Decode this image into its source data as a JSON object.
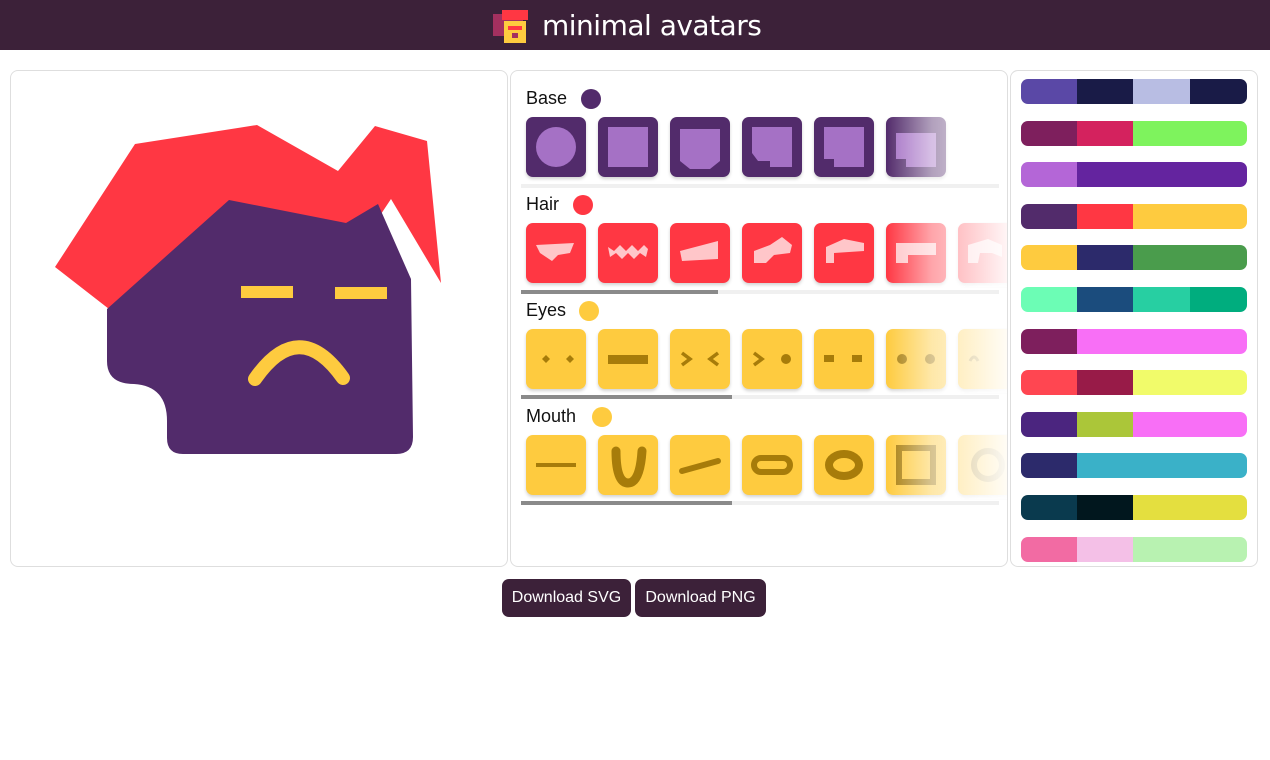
{
  "app": {
    "title": "minimal avatars",
    "logo_icon": "pixel-avatar-logo-icon",
    "header_color": "#3c2139"
  },
  "avatar": {
    "base_color": "#522b6b",
    "hair_color": "#ff3743",
    "eyes_color": "#fecb3f",
    "mouth_color": "#fecb3f",
    "expression": "frown",
    "hair_style": "spiky"
  },
  "sections": {
    "base": {
      "label": "Base",
      "color": "#522b6b",
      "shape_color": "#a571c5",
      "options": [
        "circle",
        "square",
        "cut-square",
        "notched",
        "tab",
        "step"
      ]
    },
    "hair": {
      "label": "Hair",
      "color": "#ff3743",
      "shape_color": "#ffc6c9",
      "options": [
        "wave",
        "zigzag",
        "wedge",
        "spike",
        "bob",
        "block",
        "arch"
      ]
    },
    "eyes": {
      "label": "Eyes",
      "color": "#fecb3f",
      "shape_color": "#a77c0a",
      "options": [
        "diamonds",
        "bar",
        "angles",
        "wink",
        "dashes",
        "dots",
        "arc"
      ]
    },
    "mouth": {
      "label": "Mouth",
      "color": "#fecb3f",
      "shape_color": "#a77c0a",
      "options": [
        "line",
        "u-shape",
        "slant",
        "pill",
        "ring",
        "square",
        "circle"
      ]
    }
  },
  "palettes": [
    [
      "#5a48a6",
      "#191b47",
      "#b8bde3",
      "#191b47"
    ],
    [
      "#7e1f5d",
      "#d4225e",
      "#7ef35d",
      "#7ef35d"
    ],
    [
      "#b466d7",
      "#64249f",
      "#64249f",
      "#64249f"
    ],
    [
      "#522b6b",
      "#ff3743",
      "#fecb3f",
      "#fecb3f"
    ],
    [
      "#fecb3f",
      "#2c2a6b",
      "#4a9c4c",
      "#4a9c4c"
    ],
    [
      "#6cfdb5",
      "#1b4c7d",
      "#27cfa2",
      "#00ad7e"
    ],
    [
      "#7e1f5d",
      "#f86ff6",
      "#f86ff6",
      "#f86ff6"
    ],
    [
      "#ff4651",
      "#981b48",
      "#f1fb6a",
      "#f1fb6a"
    ],
    [
      "#4b257f",
      "#abc639",
      "#f86ff6",
      "#f86ff6"
    ],
    [
      "#2c2a6b",
      "#3ab1c8",
      "#3ab1c8",
      "#3ab1c8"
    ],
    [
      "#0a3a4e",
      "#01171e",
      "#e4df3f",
      "#e4df3f"
    ],
    [
      "#f26ba3",
      "#f4c0e7",
      "#b8f2b1",
      "#b8f2b1"
    ]
  ],
  "buttons": {
    "download_svg": "Download SVG",
    "download_png": "Download PNG"
  }
}
